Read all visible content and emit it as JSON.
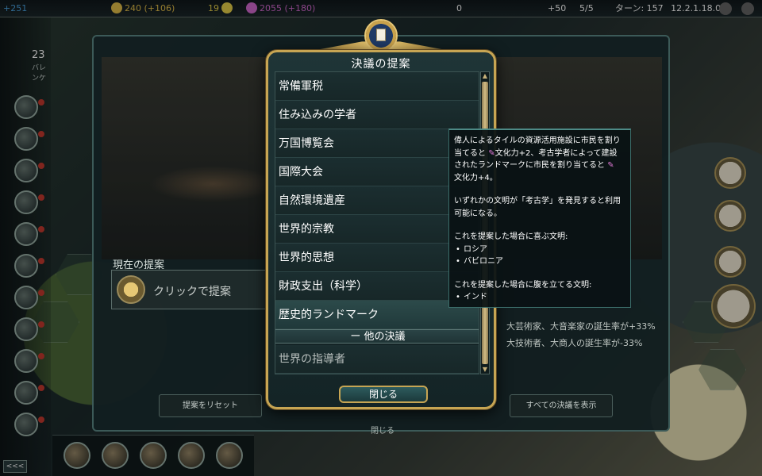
{
  "topbar": {
    "science": "+251",
    "gold": "240 (+106)",
    "happiness": "19",
    "culture": "2055 (+180)",
    "tourism": "0",
    "influence": "+50",
    "spies": "5/5",
    "turn_label": "ターン: 157",
    "version": "12.2.1.18.0",
    "colors": {
      "science": "#4aa3e0",
      "gold": "#e5c04a",
      "happiness": "#e8d24a",
      "culture": "#d56ad1"
    }
  },
  "city": {
    "population": "23",
    "name": "バレンケ"
  },
  "congress": {
    "current_proposal_label": "現在の提案",
    "click_to_propose": "クリックで提案",
    "bonus_line_1": "大芸術家、大音楽家の誕生率が+33%",
    "bonus_line_2": "大技術者、大商人の誕生率が-33%",
    "reset_button": "提案をリセット",
    "show_all_button": "すべての決議を表示",
    "close_bottom": "閉じる"
  },
  "popup": {
    "title": "決議の提案",
    "items": [
      {
        "label": "常備軍税"
      },
      {
        "label": "住み込みの学者"
      },
      {
        "label": "万国博覧会"
      },
      {
        "label": "国際大会"
      },
      {
        "label": "自然環境遺産"
      },
      {
        "label": "世界的宗教"
      },
      {
        "label": "世界的思想"
      },
      {
        "label": "財政支出（科学）"
      },
      {
        "label": "歴史的ランドマーク"
      }
    ],
    "section_header": "ー 他の決議",
    "other_items": [
      {
        "label": "世界の指導者"
      }
    ],
    "close_button": "閉じる"
  },
  "tooltip": {
    "line1": "偉人によるタイルの資源活用施設に市民を割り",
    "line2a": "当てると",
    "line2b": "文化力+2、考古学者によって建設",
    "line3": "されたランドマークに市民を割り当てると",
    "line4": "文化力+4。",
    "line5": "いずれかの文明が「考古学」を発見すると利用",
    "line6": "可能になる。",
    "pleased_header": "これを提案した場合に喜ぶ文明:",
    "pleased": [
      "ロシア",
      "バビロニア"
    ],
    "angry_header": "これを提案した場合に腹を立てる文明:",
    "angry": [
      "インド"
    ],
    "culture_icon": "culture-icon"
  }
}
